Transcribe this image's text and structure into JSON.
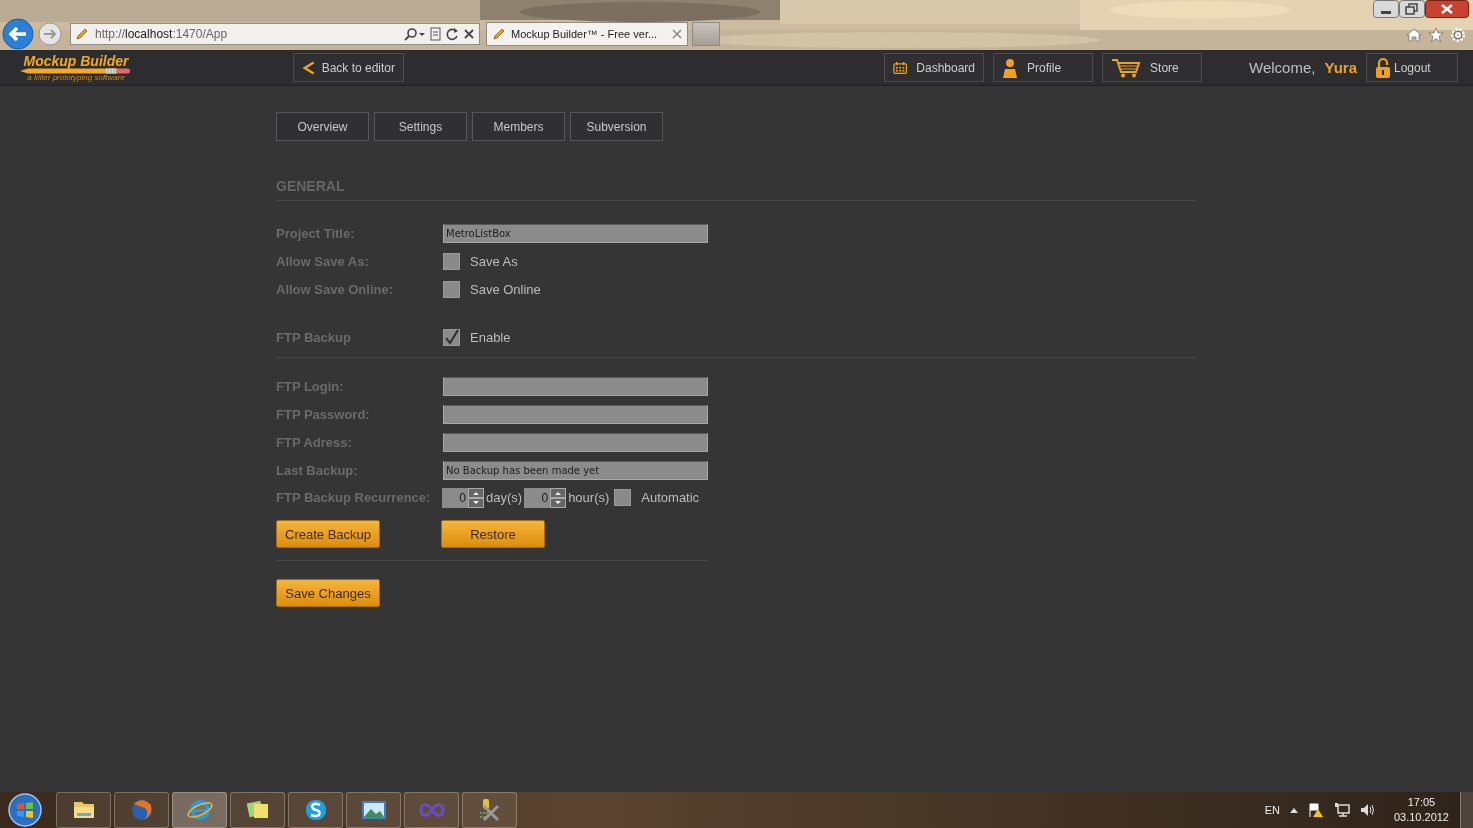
{
  "browser": {
    "address": "http://**localhost**:1470/App",
    "tab_title": "Mockup Builder™ - Free ver..."
  },
  "app_header": {
    "logo_title": "Mockup Builder",
    "logo_tagline": "a killer prototyping software",
    "back_button": "Back to editor",
    "nav": [
      {
        "label": "Dashboard",
        "kind": "calendar"
      },
      {
        "label": "Profile",
        "kind": "person"
      },
      {
        "label": "Store",
        "kind": "cart"
      }
    ],
    "welcome": "Welcome,",
    "user": "Yura",
    "logout": "Logout"
  },
  "tabs": [
    "Overview",
    "Settings",
    "Members",
    "Subversion"
  ],
  "section_title": "GENERAL",
  "general_rows": [
    {
      "kind": "text",
      "label": "Project Title:",
      "value": "MetroListBox"
    },
    {
      "kind": "checkbox",
      "label": "Allow Save As:",
      "option": "Save As",
      "checked": false
    },
    {
      "kind": "checkbox",
      "label": "Allow Save Online:",
      "option": "Save Online",
      "checked": false
    }
  ],
  "ftp_backup": {
    "label": "FTP Backup",
    "option": "Enable",
    "checked": true
  },
  "ftp_rows": [
    {
      "kind": "text",
      "label": "FTP Login:"
    },
    {
      "kind": "text",
      "label": "FTP Password:"
    },
    {
      "kind": "text",
      "label": "FTP Adress:"
    },
    {
      "kind": "text",
      "label": "Last Backup:",
      "value": "No Backup has been made yet"
    }
  ],
  "recurrence": {
    "label": "FTP Backup Recurrence:",
    "days": "0",
    "days_unit": "day(s)",
    "hours": "0",
    "hours_unit": "hour(s)",
    "option": "Automatic",
    "checked": false
  },
  "backup_buttons": [
    "Create Backup",
    "Restore"
  ],
  "save_button": "Save Changes",
  "taskbar": {
    "language": "EN",
    "time": "17:05",
    "date": "03.10.2012"
  }
}
